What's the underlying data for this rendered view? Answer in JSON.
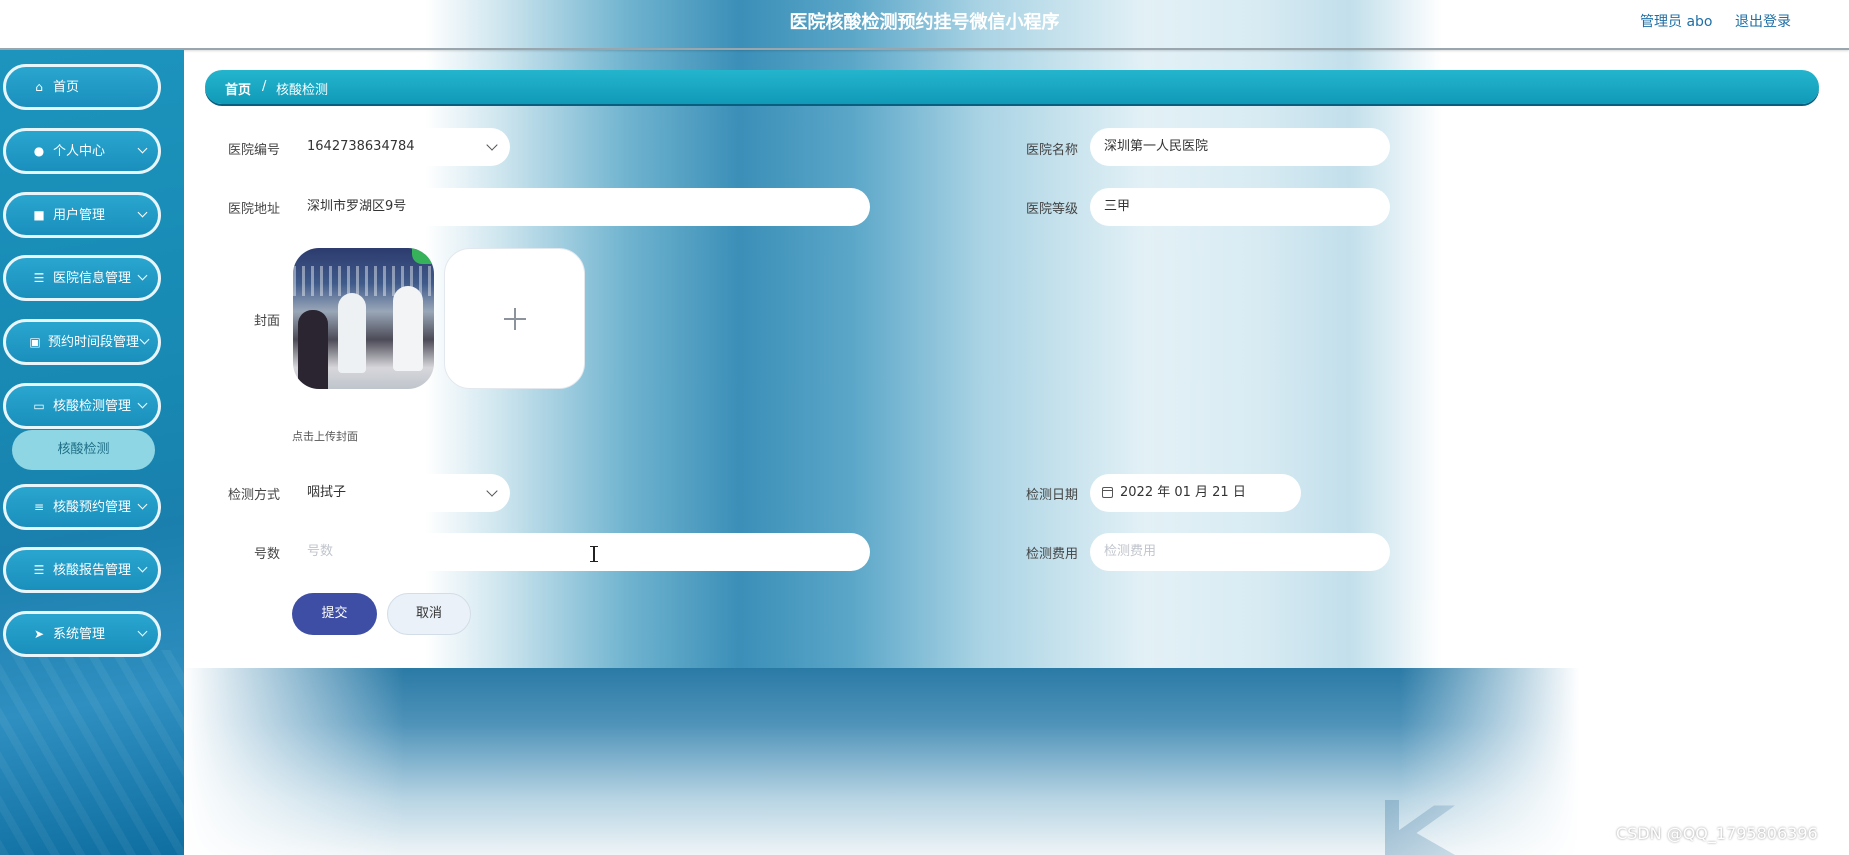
{
  "header": {
    "title": "医院核酸检测预约挂号微信小程序",
    "user": "管理员 abo",
    "logout": "退出登录"
  },
  "sidebar": {
    "items": [
      {
        "label": "首页",
        "icon": "home-icon"
      },
      {
        "label": "个人中心",
        "icon": "user-icon"
      },
      {
        "label": "用户管理",
        "icon": "briefcase-icon"
      },
      {
        "label": "医院信息管理",
        "icon": "list-icon"
      },
      {
        "label": "预约时间段管理",
        "icon": "clipboard-icon"
      },
      {
        "label": "核酸检测管理",
        "icon": "monitor-icon"
      },
      {
        "label": "核酸预约管理",
        "icon": "sliders-icon"
      },
      {
        "label": "核酸报告管理",
        "icon": "list-icon"
      },
      {
        "label": "系统管理",
        "icon": "send-icon"
      }
    ],
    "active_submenu": "核酸检测"
  },
  "breadcrumb": {
    "home": "首页",
    "separator": "/",
    "current": "核酸检测"
  },
  "form": {
    "hospital_no": {
      "label": "医院编号",
      "value": "1642738634784"
    },
    "hospital_name": {
      "label": "医院名称",
      "value": "深圳第一人民医院"
    },
    "hospital_address": {
      "label": "医院地址",
      "value": "深圳市罗湖区9号"
    },
    "hospital_level": {
      "label": "医院等级",
      "value": "三甲"
    },
    "cover": {
      "label": "封面",
      "tip": "点击上传封面"
    },
    "test_method": {
      "label": "检测方式",
      "value": "咽拭子"
    },
    "test_date": {
      "label": "检测日期",
      "value": "2022 年 01 月 21 日"
    },
    "number": {
      "label": "号数",
      "placeholder": "号数"
    },
    "test_fee": {
      "label": "检测费用",
      "placeholder": "检测费用"
    },
    "submit": "提交",
    "cancel": "取消"
  },
  "watermark": "CSDN @QQ_1795806396",
  "colors": {
    "sidebar": "#1a8fbd",
    "breadcrumb": "#17a8c5",
    "submit_button": "#3e4ea5",
    "active_submenu": "#8fd6e4"
  }
}
